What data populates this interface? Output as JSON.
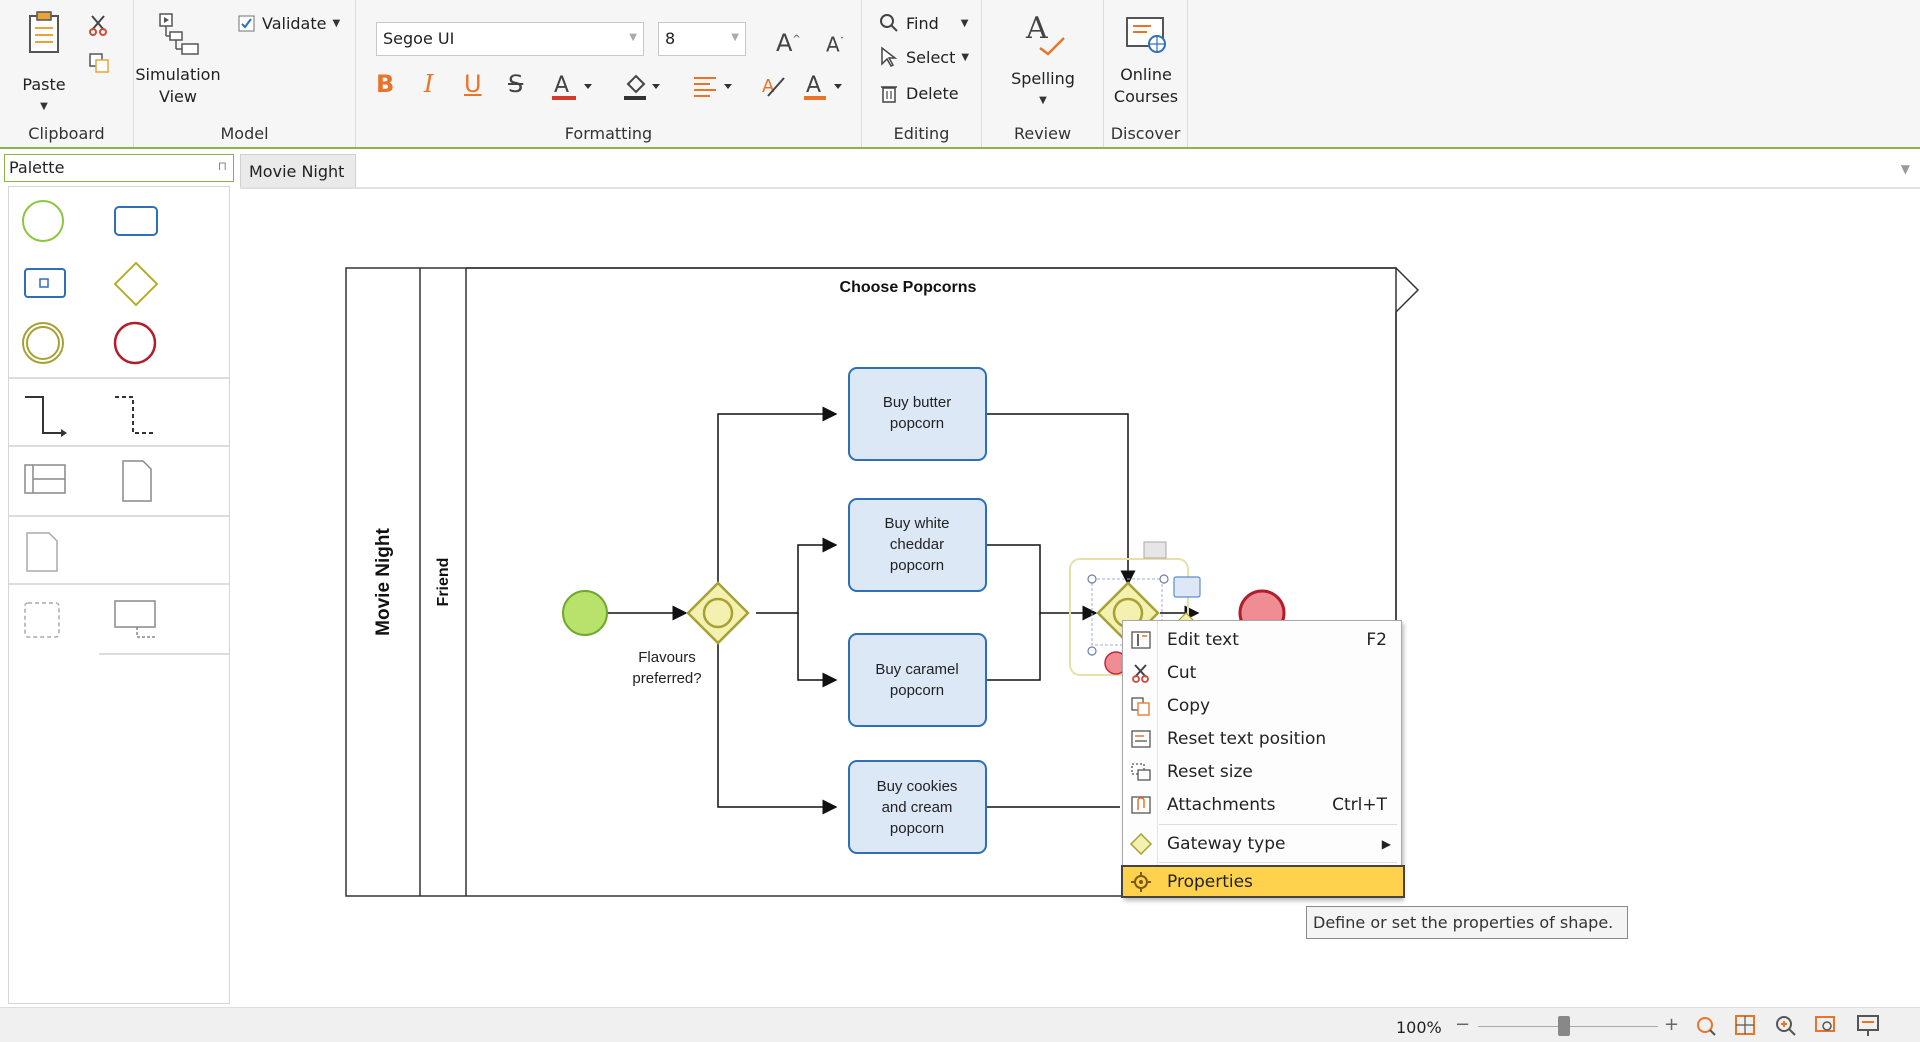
{
  "ribbon": {
    "clipboard": {
      "paste": "Paste",
      "label": "Clipboard"
    },
    "model": {
      "simulation_line1": "Simulation",
      "simulation_line2": "View",
      "validate": "Validate",
      "label": "Model"
    },
    "formatting": {
      "font_family": "Segoe UI",
      "font_size": "8",
      "label": "Formatting"
    },
    "editing": {
      "find": "Find",
      "select": "Select",
      "delete": "Delete",
      "label": "Editing"
    },
    "review": {
      "spelling": "Spelling",
      "label": "Review"
    },
    "discover": {
      "online_line1": "Online",
      "online_line2": "Courses",
      "label": "Discover"
    }
  },
  "palette": {
    "title": "Palette"
  },
  "tabs": [
    {
      "label": "Movie Night"
    }
  ],
  "diagram": {
    "pool_label": "Movie Night",
    "lane_label": "Friend",
    "subprocess_title": "Choose Popcorns",
    "gateway_label_line1": "Flavours",
    "gateway_label_line2": "preferred?",
    "tasks": [
      {
        "lines": [
          "Buy butter",
          "popcorn"
        ]
      },
      {
        "lines": [
          "Buy white",
          "cheddar",
          "popcorn"
        ]
      },
      {
        "lines": [
          "Buy caramel",
          "popcorn"
        ]
      },
      {
        "lines": [
          "Buy cookies",
          "and cream",
          "popcorn"
        ]
      }
    ]
  },
  "context_menu": {
    "items": [
      {
        "label": "Edit text",
        "shortcut": "F2"
      },
      {
        "label": "Cut",
        "shortcut": ""
      },
      {
        "label": "Copy",
        "shortcut": ""
      },
      {
        "label": "Reset text position",
        "shortcut": ""
      },
      {
        "label": "Reset size",
        "shortcut": ""
      },
      {
        "label": "Attachments",
        "shortcut": "Ctrl+T"
      },
      {
        "label": "Gateway type",
        "shortcut": ""
      },
      {
        "label": "Properties",
        "shortcut": ""
      }
    ],
    "highlighted": "Properties"
  },
  "tooltip": "Define or set the properties of shape.",
  "statusbar": {
    "zoom": "100%"
  },
  "colors": {
    "accent_green": "#8bb34a",
    "task_fill": "#dde8f7",
    "task_stroke": "#2e6fb7",
    "gateway_fill": "#f3f0b0",
    "gateway_stroke": "#a6a133",
    "start_fill": "#b8e26b",
    "end_fill": "#f08d92",
    "menu_highlight": "#ffd24d"
  }
}
